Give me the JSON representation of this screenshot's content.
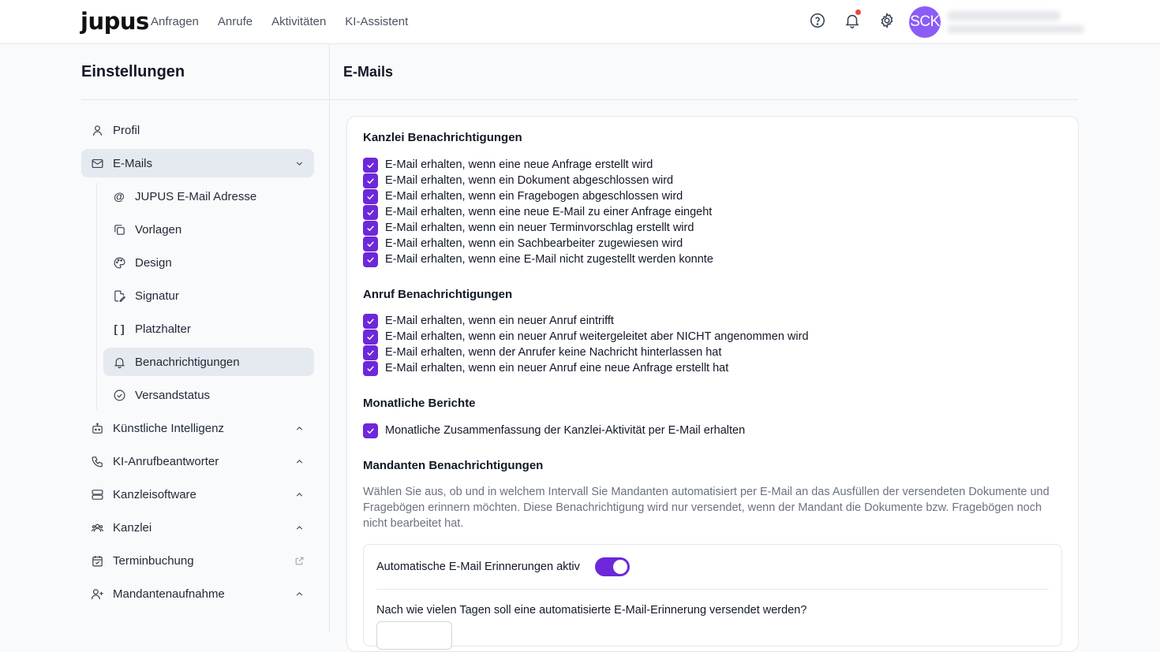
{
  "app": {
    "logo": "jupus"
  },
  "nav": [
    "Anfragen",
    "Anrufe",
    "Aktivitäten",
    "KI-Assistent"
  ],
  "user": {
    "initials": "SCK"
  },
  "colors": {
    "accent": "#6d28d9",
    "avatar": "#8b5cf6",
    "notification_dot": "#ef4444"
  },
  "sidebar": {
    "title": "Einstellungen",
    "items": {
      "profil": "Profil",
      "emails": "E-Mails",
      "jupus_email": "JUPUS E-Mail Adresse",
      "vorlagen": "Vorlagen",
      "design": "Design",
      "signatur": "Signatur",
      "platzhalter": "Platzhalter",
      "benachrichtigungen": "Benachrichtigungen",
      "versandstatus": "Versandstatus",
      "ki": "Künstliche Intelligenz",
      "ki_anruf": "KI-Anrufbeantworter",
      "kanzleisoftware": "Kanzleisoftware",
      "kanzlei": "Kanzlei",
      "terminbuchung": "Terminbuchung",
      "mandantenaufnahme": "Mandantenaufnahme"
    },
    "platzhalter_icon_text": "[ ]",
    "at_icon_text": "@"
  },
  "main": {
    "title": "E-Mails",
    "kanzlei": {
      "title": "Kanzlei Benachrichtigungen",
      "options": [
        "E-Mail erhalten, wenn eine neue Anfrage erstellt wird",
        "E-Mail erhalten, wenn ein Dokument abgeschlossen wird",
        "E-Mail erhalten, wenn ein Fragebogen abgeschlossen wird",
        "E-Mail erhalten, wenn eine neue E-Mail zu einer Anfrage eingeht",
        "E-Mail erhalten, wenn ein neuer Terminvorschlag erstellt wird",
        "E-Mail erhalten, wenn ein Sachbearbeiter zugewiesen wird",
        "E-Mail erhalten, wenn eine E-Mail nicht zugestellt werden konnte"
      ]
    },
    "anruf": {
      "title": "Anruf Benachrichtigungen",
      "options": [
        "E-Mail erhalten, wenn ein neuer Anruf eintrifft",
        "E-Mail erhalten, wenn ein neuer Anruf weitergeleitet aber NICHT angenommen wird",
        "E-Mail erhalten, wenn der Anrufer keine Nachricht hinterlassen hat",
        "E-Mail erhalten, wenn ein neuer Anruf eine neue Anfrage erstellt hat"
      ]
    },
    "berichte": {
      "title": "Monatliche Berichte",
      "options": [
        "Monatliche Zusammenfassung der Kanzlei-Aktivität per E-Mail erhalten"
      ]
    },
    "mandanten": {
      "title": "Mandanten Benachrichtigungen",
      "description": "Wählen Sie aus, ob und in welchem Intervall Sie Mandanten automatisiert per E-Mail an das Ausfüllen der versendeten Dokumente und Fragebögen erinnern möchten. Diese Benachrichtigung wird nur versendet, wenn der Mandant die Dokumente bzw. Fragebögen noch nicht bearbeitet hat.",
      "toggle_label": "Automatische E-Mail Erinnerungen aktiv",
      "toggle_on": true,
      "days_label": "Nach wie vielen Tagen soll eine automatisierte E-Mail-Erinnerung versendet werden?"
    }
  }
}
